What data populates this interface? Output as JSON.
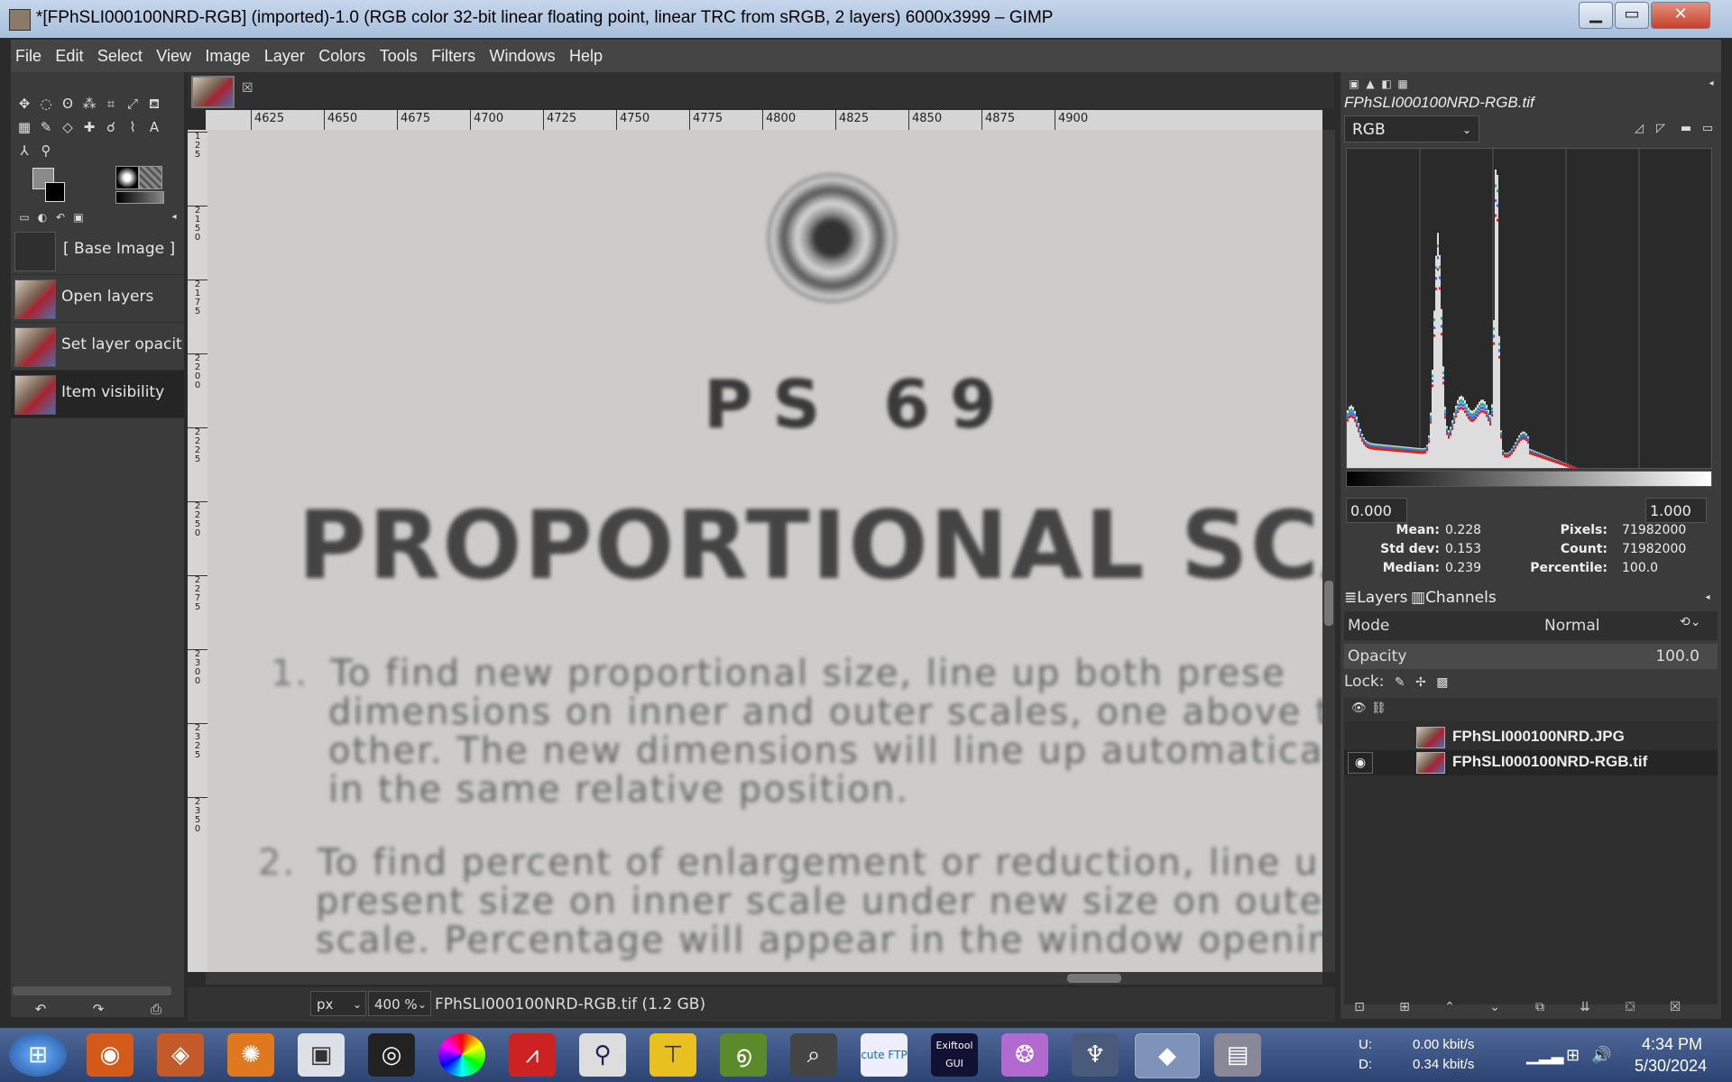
{
  "window": {
    "title": "*[FPhSLI000100NRD-RGB] (imported)-1.0 (RGB color 32-bit linear floating point, linear TRC from sRGB, 2 layers) 6000x3999 – GIMP",
    "minimize_icon": "minimize-icon",
    "maximize_icon": "maximize-icon",
    "close_icon": "close-icon"
  },
  "menu": [
    "File",
    "Edit",
    "Select",
    "View",
    "Image",
    "Layer",
    "Colors",
    "Tools",
    "Filters",
    "Windows",
    "Help"
  ],
  "undo_history": [
    {
      "label": "[ Base Image ]"
    },
    {
      "label": "Open layers"
    },
    {
      "label": "Set layer opacit"
    },
    {
      "label": "Item visibility"
    }
  ],
  "ruler": {
    "h_ticks": [
      "4625",
      "4650",
      "4675",
      "4700",
      "4725",
      "4750",
      "4775",
      "4800",
      "4825",
      "4850",
      "4875",
      "4900"
    ],
    "v_ticks": [
      "125",
      "2150",
      "2175",
      "2200",
      "2225",
      "2250",
      "2275",
      "2300",
      "2325",
      "2350"
    ]
  },
  "canvas": {
    "line1": "PS 69",
    "line2": "PROPORTIONAL SCALE",
    "para1_num": "1.",
    "para1": [
      "To find new proportional size, line up both prese",
      "dimensions on inner and outer scales, one above t",
      "other. The new dimensions will line up automatica",
      "in the same relative position."
    ],
    "para2_num": "2.",
    "para2": [
      "To find percent of enlargement or reduction, line u",
      "present size on inner scale under new size on oute",
      "scale. Percentage will appear in the window openin"
    ]
  },
  "status": {
    "unit": "px",
    "zoom": "400 %",
    "file_info": "FPhSLI000100NRD-RGB.tif (1.2 GB)"
  },
  "histogram": {
    "title": "FPhSLI000100NRD-RGB.tif",
    "channel": "RGB",
    "range_low": "0.000",
    "range_high": "1.000",
    "stats": {
      "mean_label": "Mean:",
      "mean": "0.228",
      "stddev_label": "Std dev:",
      "stddev": "0.153",
      "median_label": "Median:",
      "median": "0.239",
      "pixels_label": "Pixels:",
      "pixels": "71982000",
      "count_label": "Count:",
      "count": "71982000",
      "percentile_label": "Percentile:",
      "percentile": "100.0"
    }
  },
  "layers_panel": {
    "tab_layers": "Layers",
    "tab_channels": "Channels",
    "mode_label": "Mode",
    "mode_value": "Normal",
    "opacity_label": "Opacity",
    "opacity_value": "100.0",
    "lock_label": "Lock:",
    "layers": [
      {
        "name": "FPhSLI000100NRD.JPG",
        "visible": false
      },
      {
        "name": "FPhSLI000100NRD-RGB.tif",
        "visible": true
      }
    ]
  },
  "taskbar": {
    "net_up_label": "U:",
    "net_up": "0.00 kbit/s",
    "net_down_label": "D:",
    "net_down": "0.34 kbit/s",
    "time": "4:34 PM",
    "date": "5/30/2024",
    "exiftool_label": "Exiftool GUI",
    "cuteftp_label": "cute FTP"
  },
  "colors": {
    "accent": "#4e6898",
    "panel": "#3b3b3b",
    "canvas_paper": "#cdcccb"
  }
}
